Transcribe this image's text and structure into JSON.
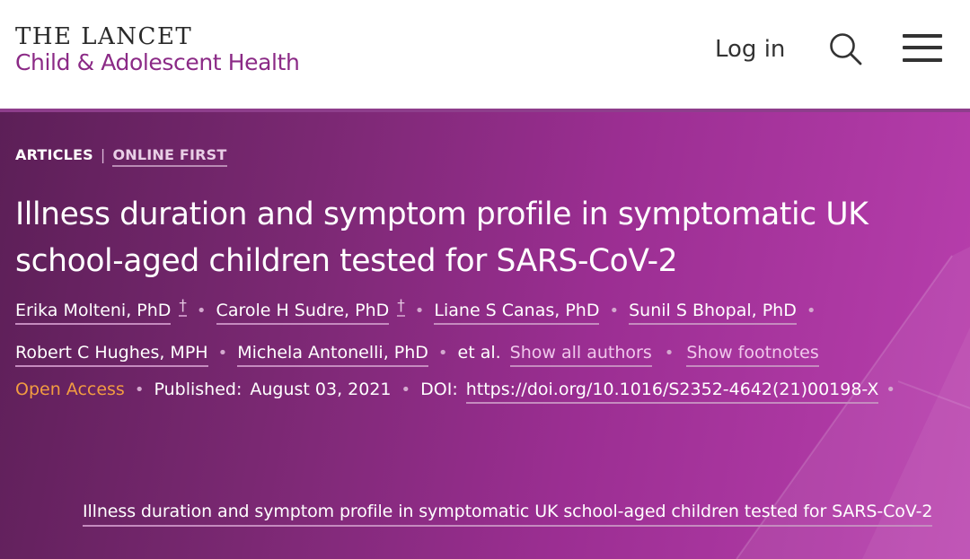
{
  "header": {
    "logo_line1": "THE LANCET",
    "logo_line2": "Child & Adolescent Health",
    "login_label": "Log in",
    "search_icon": "search-icon",
    "menu_icon": "hamburger-menu-icon"
  },
  "article": {
    "section": "ARTICLES",
    "divider": "|",
    "status": "ONLINE FIRST",
    "title": "Illness duration and symptom profile in symptomatic UK school-aged children tested for SARS-CoV-2",
    "authors": [
      {
        "name": "Erika Molteni, PhD",
        "mark": "†"
      },
      {
        "name": "Carole H Sudre, PhD",
        "mark": "†"
      },
      {
        "name": "Liane S Canas, PhD",
        "mark": ""
      },
      {
        "name": "Sunil S Bhopal, PhD",
        "mark": ""
      },
      {
        "name": "Robert C Hughes, MPH",
        "mark": ""
      },
      {
        "name": "Michela Antonelli, PhD",
        "mark": ""
      }
    ],
    "et_al": "et al.",
    "show_all_authors": "Show all authors",
    "show_footnotes": "Show footnotes",
    "open_access": "Open Access",
    "published_label": "Published:",
    "published_date": "August 03, 2021",
    "doi_label": "DOI:",
    "doi": "https://doi.org/10.1016/S2352-4642(21)00198-X",
    "caption": "Illness duration and symptom profile in symptomatic UK school-aged children tested for SARS-CoV-2"
  },
  "colors": {
    "brand_purple": "#8b2a86",
    "open_access_orange": "#f29c41",
    "hero_start": "#5c1f57",
    "hero_end": "#b93fae"
  }
}
